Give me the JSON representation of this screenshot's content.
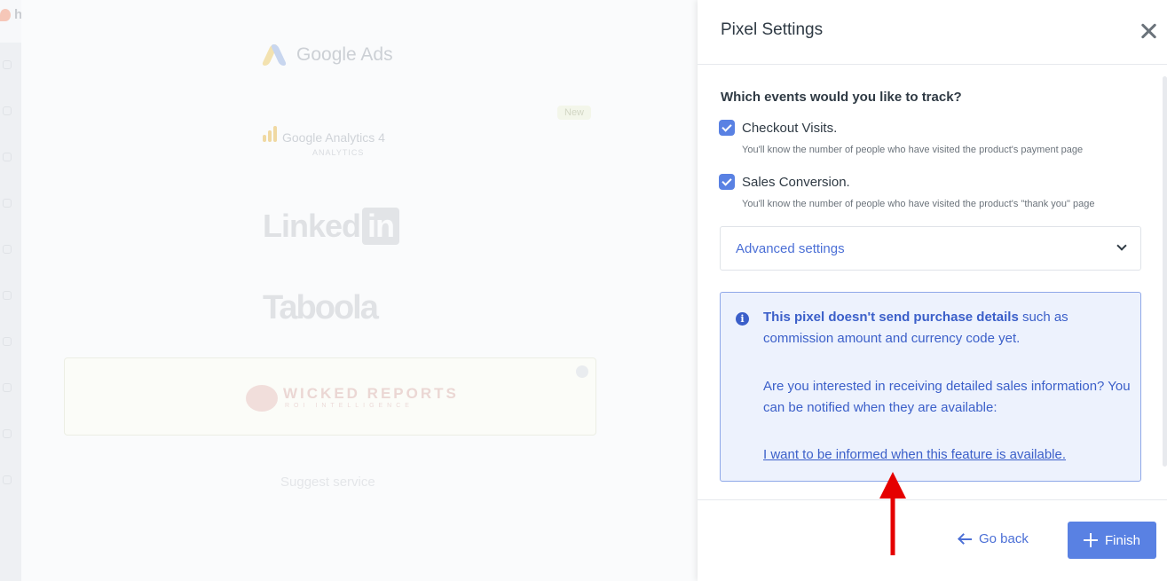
{
  "background": {
    "logo_text": "hotmart",
    "services": {
      "google_ads": "Google Ads",
      "ga4": "Google Analytics 4",
      "ga4_sub": "ANALYTICS",
      "ga4_badge": "New",
      "linkedin_main": "Linked",
      "linkedin_in": "in",
      "taboola": "Taboola",
      "wicked_reports": "WICKED REPORTS",
      "wicked_reports_sub": "ROI INTELLIGENCE"
    },
    "suggest_service": "Suggest service"
  },
  "drawer": {
    "title": "Pixel Settings",
    "question": "Which events would you like to track?",
    "events": [
      {
        "label": "Checkout Visits.",
        "description": "You'll know the number of people who have visited the product's payment page",
        "checked": true
      },
      {
        "label": "Sales Conversion.",
        "description": "You'll know the number of people who have visited the product's \"thank you\" page",
        "checked": true
      }
    ],
    "advanced_settings": "Advanced settings",
    "info": {
      "icon": "info-icon",
      "bold": "This pixel doesn't send purchase details",
      "rest": " such as commission amount and currency code yet.",
      "paragraph2": "Are you interested in receiving detailed sales information? You can be notified when they are available:",
      "link": "I want to be informed when this feature is available."
    },
    "footer": {
      "go_back": "Go back",
      "finish": "Finish"
    }
  },
  "colors": {
    "primary": "#5981e3",
    "link": "#4b6fd6",
    "info_bg": "#edf2fd",
    "info_border": "#8fa8e8",
    "annotation": "#e50000"
  }
}
